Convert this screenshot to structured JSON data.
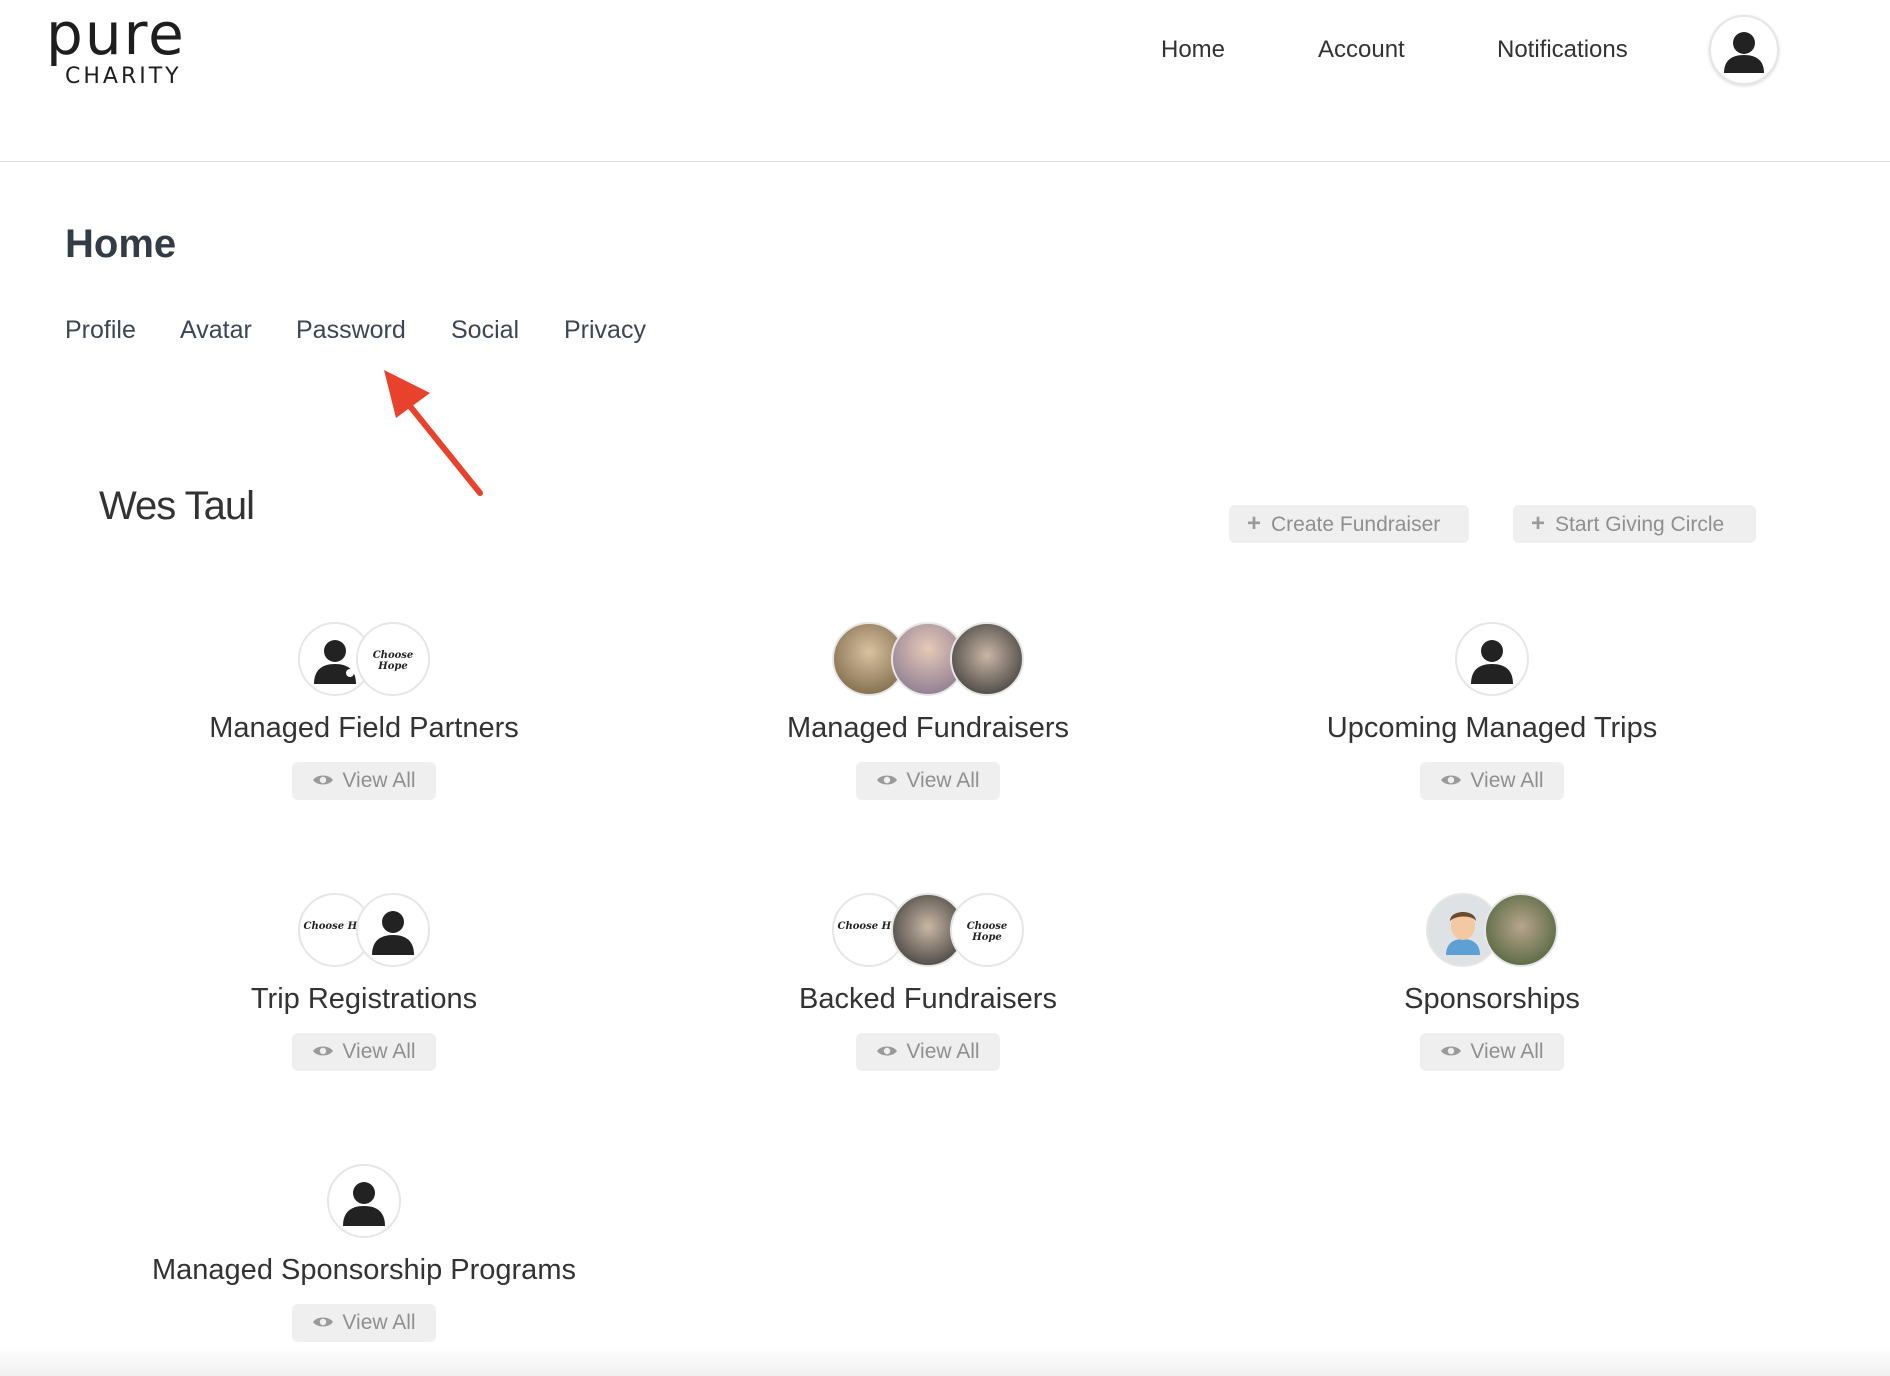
{
  "brand": {
    "logo_word": "pure",
    "logo_sub": "CHARITY"
  },
  "top_nav": [
    "Home",
    "Account",
    "Notifications"
  ],
  "page_title": "Home",
  "sub_nav": [
    "Profile",
    "Avatar",
    "Password",
    "Social",
    "Privacy"
  ],
  "user_name": "Wes Taul",
  "actions": {
    "create_fundraiser": "Create Fundraiser",
    "start_giving_circle": "Start Giving Circle"
  },
  "avatar_text": {
    "choose_hope": "Choose Hope",
    "choose_his": "Choose His"
  },
  "cards": [
    {
      "title": "Managed Field Partners",
      "button": "View All"
    },
    {
      "title": "Managed Fundraisers",
      "button": "View All"
    },
    {
      "title": "Upcoming Managed Trips",
      "button": "View All"
    },
    {
      "title": "Trip Registrations",
      "button": "View All"
    },
    {
      "title": "Backed Fundraisers",
      "button": "View All"
    },
    {
      "title": "Sponsorships",
      "button": "View All"
    },
    {
      "title": "Managed Sponsorship Programs",
      "button": "View All"
    }
  ],
  "colors": {
    "arrow": "#e8412c",
    "heading": "#333b44",
    "button_bg": "#efefef",
    "button_text": "#8f8f8f"
  }
}
